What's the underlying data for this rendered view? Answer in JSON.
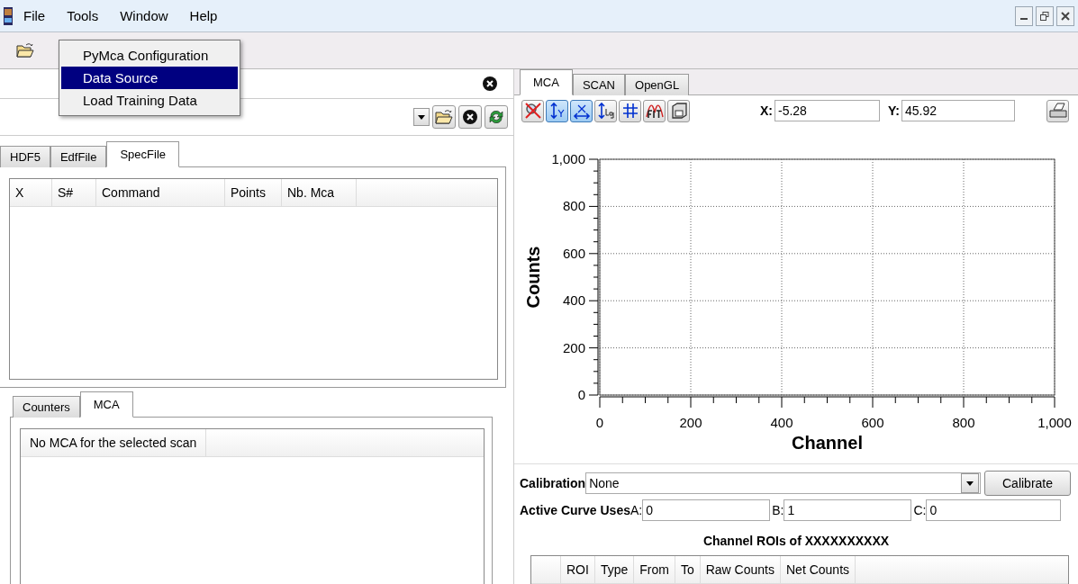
{
  "menubar": {
    "items": [
      {
        "label": "File"
      },
      {
        "label": "Tools"
      },
      {
        "label": "Window"
      },
      {
        "label": "Help"
      }
    ]
  },
  "tools_menu": {
    "items": [
      {
        "label": "PyMca Configuration",
        "selected": false
      },
      {
        "label": "Data Source",
        "selected": true
      },
      {
        "label": "Load Training Data",
        "selected": false
      }
    ]
  },
  "source_panel": {
    "tabs": [
      {
        "label": "HDF5",
        "selected": false
      },
      {
        "label": "EdfFile",
        "selected": false
      },
      {
        "label": "SpecFile",
        "selected": true
      }
    ],
    "scan_table": {
      "columns": [
        "X",
        "S#",
        "Command",
        "Points",
        "Nb. Mca"
      ]
    },
    "bottom_tabs": [
      {
        "label": "Counters",
        "selected": false
      },
      {
        "label": "MCA",
        "selected": true
      }
    ],
    "mca_table": {
      "columns": [
        "No MCA for the selected scan"
      ]
    }
  },
  "plot_panel": {
    "tabs": [
      {
        "label": "MCA",
        "selected": true
      },
      {
        "label": "SCAN",
        "selected": false
      },
      {
        "label": "OpenGL",
        "selected": false
      }
    ],
    "tools": [
      {
        "kind": "reset-zoom",
        "on": false
      },
      {
        "kind": "autoscale-y",
        "on": true
      },
      {
        "kind": "autoscale-x",
        "on": true
      },
      {
        "kind": "log",
        "on": false
      },
      {
        "kind": "grid",
        "on": false
      },
      {
        "kind": "fit",
        "on": false
      },
      {
        "kind": "save",
        "on": false
      }
    ],
    "x_readout": {
      "label": "X:",
      "value": "-5.28"
    },
    "y_readout": {
      "label": "Y:",
      "value": "45.92"
    },
    "chart_data": {
      "type": "line",
      "grid": true,
      "xlabel": "Channel",
      "ylabel": "Counts",
      "xlim": [
        0,
        1000
      ],
      "ylim": [
        0,
        1000
      ],
      "xticks": [
        0,
        200,
        400,
        600,
        800,
        {
          "value": 1000,
          "label": "1,000"
        }
      ],
      "yticks": [
        0,
        200,
        400,
        600,
        800,
        {
          "value": 1000,
          "label": "1,000"
        }
      ]
    },
    "calibration": {
      "label": "Calibration",
      "value": "None",
      "button": "Calibrate"
    },
    "active_curve": {
      "label": "Active Curve Uses",
      "fields": [
        {
          "label": "A:",
          "value": "0"
        },
        {
          "label": "B:",
          "value": "1"
        },
        {
          "label": "C:",
          "value": "0"
        }
      ]
    },
    "roi_title": "Channel ROIs of XXXXXXXXXX",
    "roi_table": {
      "columns": [
        "ROI",
        "Type",
        "From",
        "To",
        "Raw Counts",
        "Net Counts"
      ]
    }
  }
}
